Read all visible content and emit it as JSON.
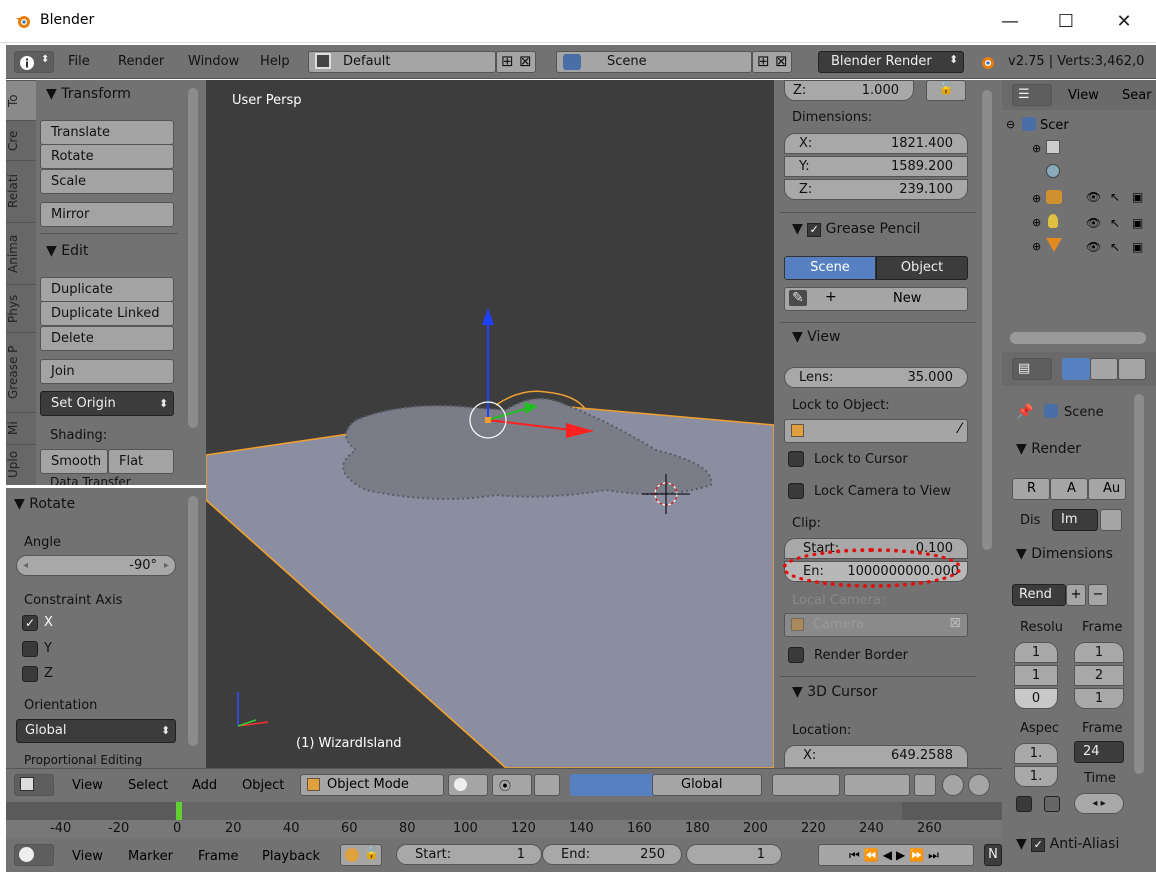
{
  "window": {
    "title": "Blender",
    "minimize": "—",
    "maximize": "☐",
    "close": "✕"
  },
  "info_header": {
    "menus": [
      "File",
      "Render",
      "Window",
      "Help"
    ],
    "screen_layout": "Default",
    "scene": "Scene",
    "engine": "Blender Render",
    "stats": "v2.75 | Verts:3,462,0"
  },
  "tool_tabs": [
    "To",
    "Cre",
    "Relati",
    "Anima",
    "Phys",
    "Grease P",
    "Mi",
    "Uplo"
  ],
  "tool_shelf": {
    "transform_header": "Transform",
    "transform_buttons": [
      "Translate",
      "Rotate",
      "Scale"
    ],
    "mirror": "Mirror",
    "edit_header": "Edit",
    "edit_buttons": [
      "Duplicate",
      "Duplicate Linked",
      "Delete"
    ],
    "join": "Join",
    "set_origin": "Set Origin",
    "shading_label": "Shading:",
    "smooth": "Smooth",
    "flat": "Flat",
    "cut_text": "Data Transfer"
  },
  "redo_panel": {
    "header": "Rotate",
    "angle_label": "Angle",
    "angle_value": "-90°",
    "constraint_label": "Constraint Axis",
    "axes": [
      {
        "label": "X",
        "checked": true
      },
      {
        "label": "Y",
        "checked": false
      },
      {
        "label": "Z",
        "checked": false
      }
    ],
    "orientation_label": "Orientation",
    "orientation_value": "Global",
    "cut_text": "Proportional Editing"
  },
  "viewport": {
    "view_name": "User Persp",
    "object_label": "(1) WizardIsland"
  },
  "n_panel": {
    "z_top_label": "Z:",
    "z_top_value": "1.000",
    "dimensions_label": "Dimensions:",
    "dims": [
      {
        "axis": "X:",
        "value": "1821.400"
      },
      {
        "axis": "Y:",
        "value": "1589.200"
      },
      {
        "axis": "Z:",
        "value": "239.100"
      }
    ],
    "grease_header": "Grease Pencil",
    "gp_scene": "Scene",
    "gp_object": "Object",
    "gp_new": "New",
    "view_header": "View",
    "lens_label": "Lens:",
    "lens_value": "35.000",
    "lock_object_label": "Lock to Object:",
    "lock_cursor": "Lock to Cursor",
    "lock_camera": "Lock Camera to View",
    "clip_label": "Clip:",
    "clip_start_label": "Start:",
    "clip_start_value": "0.100",
    "clip_end_label": "En:",
    "clip_end_value": "1000000000.000",
    "local_camera_label": "Local Camera:",
    "camera_value": "Camera",
    "render_border": "Render Border",
    "cursor_header": "3D Cursor",
    "location_label": "Location:",
    "loc_x_label": "X:",
    "loc_x_value": "649.2588"
  },
  "outliner": {
    "view": "View",
    "search": "Sear",
    "scene": "Scer"
  },
  "properties": {
    "scene_label": "Scene",
    "render_header": "Render",
    "render_buttons": [
      "R",
      "A",
      "Au"
    ],
    "display_label": "Dis",
    "display_value": "Im",
    "dimensions_header": "Dimensions",
    "preset": "Rend",
    "resolution_label": "Resolu",
    "frame_label": "Frame",
    "res_values": [
      "1",
      "1",
      "0"
    ],
    "frame_values": [
      "1",
      "2",
      "1"
    ],
    "aspect_label": "Aspec",
    "frame_rate_label": "Frame",
    "aspect_values": [
      "1.",
      "1."
    ],
    "fps": "24",
    "time_label": "Time",
    "aa_header": "Anti-Aliasi"
  },
  "view3d_header": {
    "menus": [
      "View",
      "Select",
      "Add",
      "Object"
    ],
    "mode": "Object Mode",
    "orientation": "Global"
  },
  "timeline": {
    "ruler": [
      "-40",
      "-20",
      "0",
      "20",
      "40",
      "60",
      "80",
      "100",
      "120",
      "140",
      "160",
      "180",
      "200",
      "220",
      "240",
      "260"
    ],
    "menus": [
      "View",
      "Marker",
      "Frame",
      "Playback"
    ],
    "start_label": "Start:",
    "start_value": "1",
    "end_label": "End:",
    "end_value": "250",
    "current": "1",
    "trailing": "N"
  },
  "colors": {
    "accent_blue": "#5680c2",
    "selection_orange": "#f0a030",
    "annotation_red": "#e01010"
  }
}
